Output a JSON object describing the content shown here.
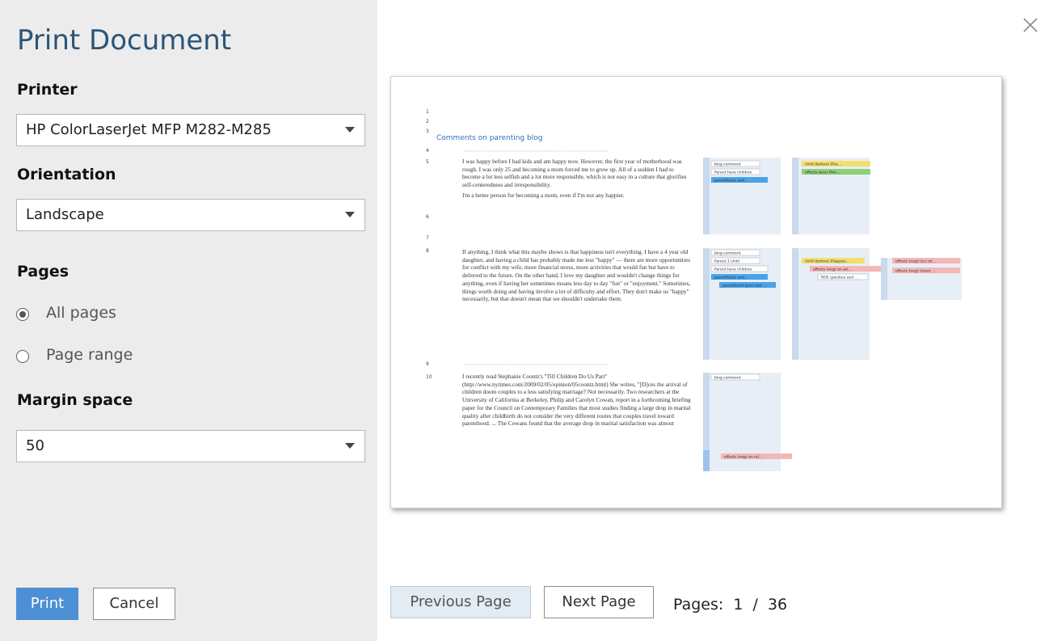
{
  "dialog": {
    "title": "Print Document",
    "close_icon": "close-icon"
  },
  "printer": {
    "label": "Printer",
    "value": "HP ColorLaserJet MFP M282-M285"
  },
  "orientation": {
    "label": "Orientation",
    "value": "Landscape"
  },
  "pages": {
    "label": "Pages",
    "all_label": "All pages",
    "range_label": "Page range",
    "selected": "All pages"
  },
  "margin": {
    "label": "Margin space",
    "value": "50"
  },
  "buttons": {
    "print": "Print",
    "cancel": "Cancel",
    "previous": "Previous Page",
    "next": "Next Page"
  },
  "pagination": {
    "label": "Pages:",
    "current": "1",
    "separator": "/",
    "total": "36"
  },
  "preview": {
    "heading": "Comments on parenting blog",
    "line_numbers": [
      "1",
      "2",
      "3",
      "4",
      "5",
      "6",
      "7",
      "8",
      "9",
      "10"
    ],
    "paragraphs": [
      "I was happy before I had kids and am happy now. However, the first year of motherhood was rough. I was only 25 and becoming a mom forced me to grow up. All of a sudden I had to become a lot less selfish and a lot more responsible, which is not easy in a culture that glorifies self-centeredness and irresponsibility.",
      "I'm a better person for becoming a mom, even if I'm not any happier.",
      "If anything, I think what this maybe shows is that happiness isn't everything. I have a 4 year old daughter, and having a child has probably made me less \"happy\" — there are more opportunities for conflict with my wife, more financial stress, more activities that would fun but have to deferred to the future. On the other hand, I love my daughter and wouldn't change things for anything, even if having her sometimes means less day to day \"fun\" or \"enjoyment.\" Sometimes, things worth doing and having involve a lot of difficulty and effort. They don't make us \"happy\" necessarily, but that doesn't mean that we shouldn't undertake them.",
      "I recently read Stephanie Coontz's \"Till Children Do Us Part\" (http://www.nytimes.com/2009/02/05/opinion/05coontz.html) She writes, \"[D]ces the arrival of children doom couples to a less satisfying marriage? Not necessarily. Two researchers at the University of California at Berkeley, Philip and Carolyn Cowan, report in a forthcoming briefing paper for the Council on Contemporary Families that most studies finding a large drop in marital quality after childbirth do not consider the very different routes that couples travel toward parenthood. ... The Cowans found that the average drop in marital satisfaction was almost"
    ],
    "margin_codes_1": [
      "blog comment",
      "Parent have children",
      "parenthood, and..."
    ],
    "margin_codes_2": [
      "child (before) (Pos...",
      "effects (pos) (Pos ..."
    ],
    "margin_codes_3": [
      "blog comment",
      "Parent 1 child",
      "Parent have children",
      "parenthood, and...",
      "parenthood (pos) and ..."
    ],
    "margin_codes_4": [
      "child (before) (Happen...",
      "effects (neg) on ad...",
      "ROE (positive and ..."
    ],
    "margin_codes_5": [
      "effects (neg) (sc) rel...",
      "effects (neg) (more ..."
    ],
    "margin_codes_6": [
      "blog comment",
      "effects (neg) on rel..."
    ]
  },
  "colors": {
    "accent": "#4d8fd4",
    "title": "#2d5478",
    "panel": "#ececec",
    "code_blue": "#4aa3e8",
    "code_yellow": "#f4df6e",
    "code_green": "#8fd07a",
    "code_pink": "#f3b7b7"
  }
}
